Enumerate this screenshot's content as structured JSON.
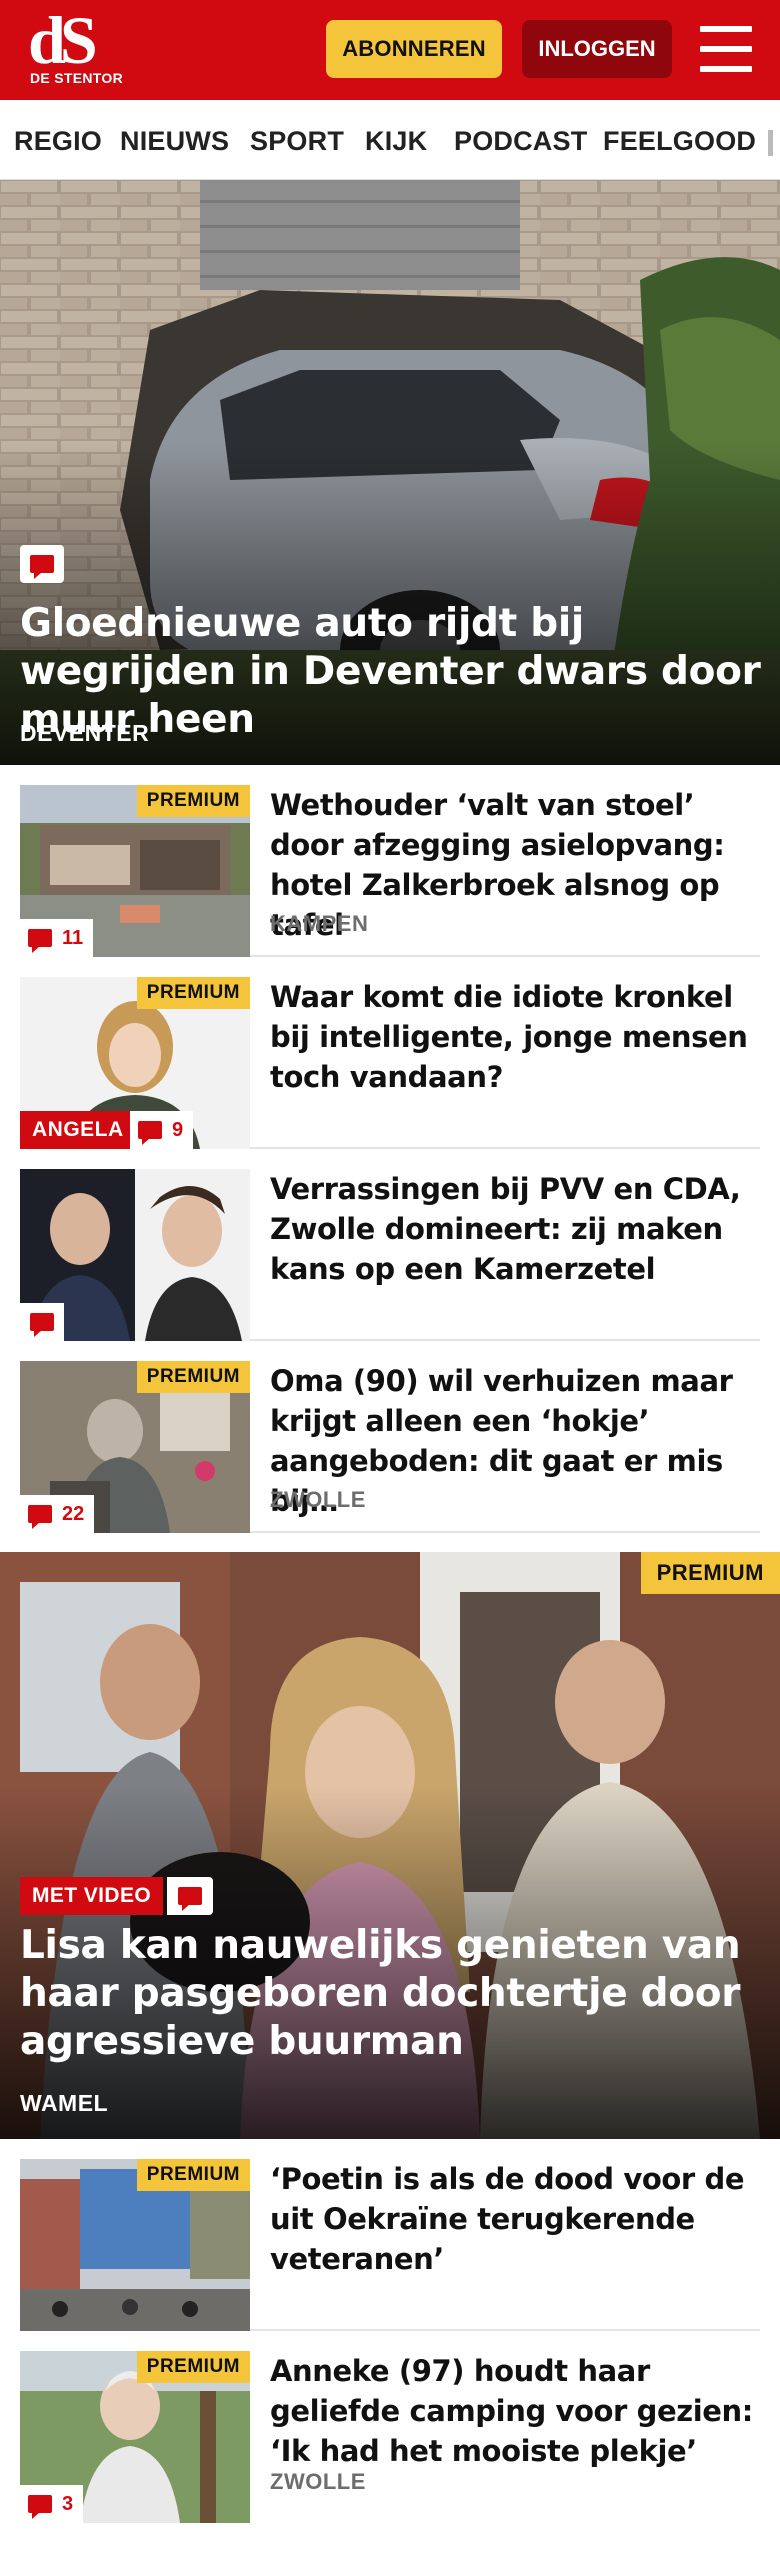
{
  "header": {
    "logo_mark": "dS",
    "logo_text": "DE STENTOR",
    "subscribe_label": "ABONNEREN",
    "login_label": "INLOGGEN",
    "brand_color": "#d10a11",
    "accent_color": "#f4c53a",
    "menu_icon": "hamburger-menu-icon"
  },
  "nav": {
    "items": [
      "REGIO",
      "NIEUWS",
      "SPORT",
      "KIJK",
      "PODCAST",
      "FEELGOOD"
    ]
  },
  "hero": {
    "title": "Gloednieuwe auto rijdt bij wegrijden in Deventer dwars door muur heen",
    "location": "DEVENTER",
    "comment_icon": "comment-icon"
  },
  "articles1": [
    {
      "title": "Wethouder ‘valt van stoel’ door afzegging asielopvang: hotel Zalkerbroek alsnog op tafel",
      "location": "KAMPEN",
      "premium": "PREMIUM",
      "comments": "11"
    },
    {
      "title": "Waar komt die idiote kronkel bij intelligente, jonge mensen toch vandaan?",
      "location": "",
      "premium": "PREMIUM",
      "label": "ANGELA",
      "comments": "9"
    },
    {
      "title": "Verrassingen bij PVV en CDA, Zwolle domineert: zij maken kans op een Kamerzetel",
      "location": "",
      "premium": "",
      "comments": ""
    },
    {
      "title": "Oma (90) wil verhuizen maar krijgt alleen een ‘hokje’ aangeboden: dit gaat er mis bij…",
      "location": "ZWOLLE",
      "premium": "PREMIUM",
      "comments": "22"
    }
  ],
  "hero2": {
    "premium": "PREMIUM",
    "video_label": "MET VIDEO",
    "title": "Lisa kan nauwelijks genieten van haar pasgeboren dochtertje door agressieve buurman",
    "location": "WAMEL"
  },
  "articles2": [
    {
      "title": "‘Poetin is als de dood voor de uit Oekraïne terugkerende veteranen’",
      "location": "",
      "premium": "PREMIUM",
      "comments": ""
    },
    {
      "title": "Anneke (97) houdt haar geliefde camping voor gezien: ‘Ik had het mooiste plekje’",
      "location": "ZWOLLE",
      "premium": "PREMIUM",
      "comments": "3"
    }
  ]
}
